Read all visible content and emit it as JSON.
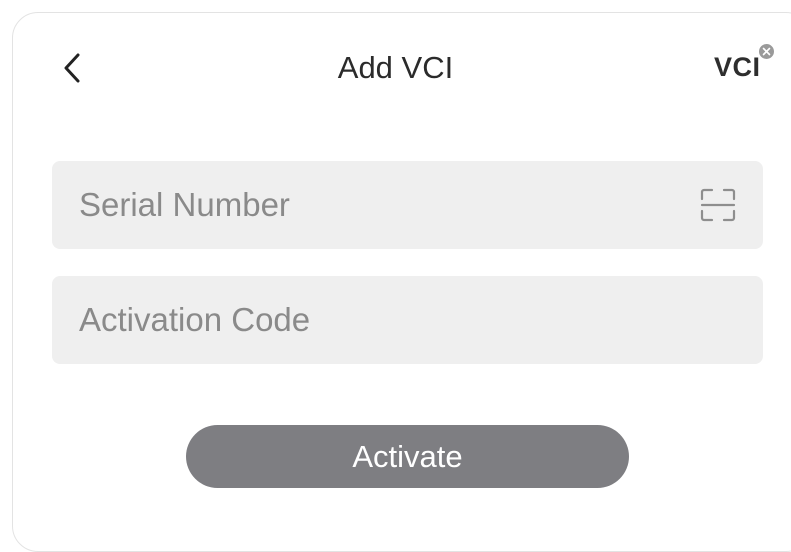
{
  "header": {
    "title": "Add VCI",
    "back_icon": "chevron-left-icon",
    "vci_label": "VCI",
    "vci_badge_icon": "close-icon"
  },
  "form": {
    "serial_number": {
      "placeholder": "Serial Number",
      "value": "",
      "scan_icon": "scan-icon"
    },
    "activation_code": {
      "placeholder": "Activation Code",
      "value": ""
    },
    "activate_label": "Activate"
  },
  "colors": {
    "field_background": "#efefef",
    "button_background": "#7e7e82",
    "button_text": "#ffffff",
    "placeholder_text": "#8a8a8a",
    "title_text": "#2b2b2b"
  }
}
